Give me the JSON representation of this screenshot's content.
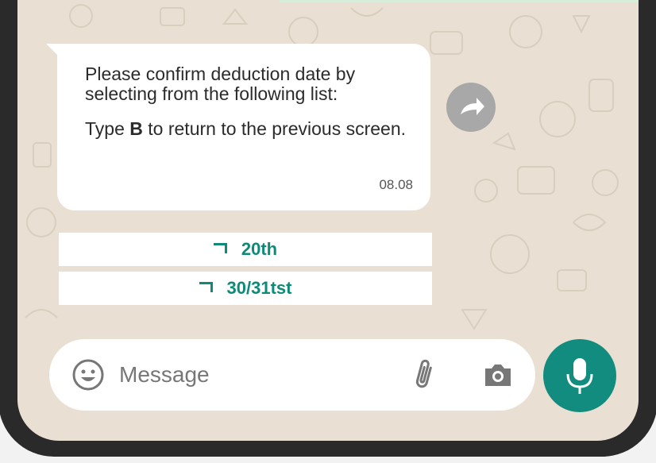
{
  "message": {
    "line1": "Please confirm deduction date by selecting from the following list:",
    "line2_prefix": "Type ",
    "line2_key": "B",
    "line2_suffix": " to return to the previous screen.",
    "time": "08.08"
  },
  "options": [
    {
      "label": "20th"
    },
    {
      "label": "30/31tst"
    }
  ],
  "composer": {
    "placeholder": "Message"
  },
  "colors": {
    "accent": "#128c7e",
    "option_text": "#0f8a78",
    "wallpaper": "#e9e0d3",
    "bubble": "#ffffff"
  },
  "icons": {
    "forward": "forward-arrow-icon",
    "emoji": "smiley-face-icon",
    "attach": "paperclip-icon",
    "camera": "camera-icon",
    "mic": "microphone-icon"
  }
}
